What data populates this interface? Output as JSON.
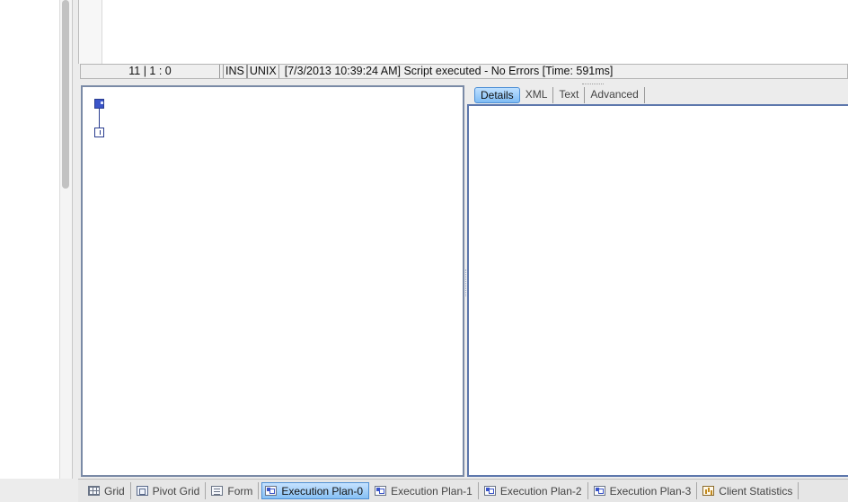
{
  "status_bar": {
    "position": "11 | 1 : 0",
    "insert_mode": "INS",
    "line_ending": "UNIX",
    "message": "[7/3/2013 10:39:24 AM] Script executed - No Errors [Time: 591ms]"
  },
  "details": {
    "tabs": [
      {
        "label": "Details",
        "active": true
      },
      {
        "label": "XML",
        "active": false
      },
      {
        "label": "Text",
        "active": false
      },
      {
        "label": "Advanced",
        "active": false
      }
    ]
  },
  "bottom_tabs": [
    {
      "label": "Grid",
      "icon": "grid-icon",
      "active": false
    },
    {
      "label": "Pivot Grid",
      "icon": "pivot-grid-icon",
      "active": false
    },
    {
      "label": "Form",
      "icon": "form-icon",
      "active": false
    },
    {
      "label": "Execution Plan-0",
      "icon": "execution-plan-icon",
      "active": true
    },
    {
      "label": "Execution Plan-1",
      "icon": "execution-plan-icon",
      "active": false
    },
    {
      "label": "Execution Plan-2",
      "icon": "execution-plan-icon",
      "active": false
    },
    {
      "label": "Execution Plan-3",
      "icon": "execution-plan-icon",
      "active": false
    },
    {
      "label": "Client Statistics",
      "icon": "client-statistics-icon",
      "active": false
    }
  ],
  "colors": {
    "active_tab": "#86c0f4",
    "panel_border": "#5d77ac",
    "plan_node": "#3b55c9"
  }
}
